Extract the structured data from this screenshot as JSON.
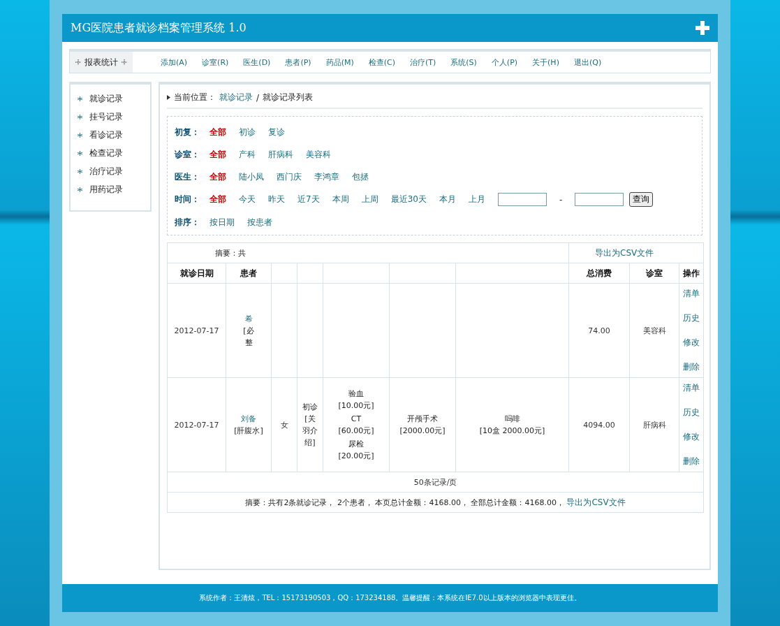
{
  "header": {
    "title": "MG医院患者就诊档案管理系统 1.0"
  },
  "menu": {
    "current": "报表统计",
    "items": [
      "添加(A)",
      "诊室(R)",
      "医生(D)",
      "患者(P)",
      "药品(M)",
      "检查(C)",
      "治疗(T)",
      "系统(S)",
      "个人(P)",
      "关于(H)",
      "退出(Q)"
    ]
  },
  "sidebar": {
    "items": [
      "就诊记录",
      "挂号记录",
      "看诊记录",
      "检查记录",
      "治疗记录",
      "用药记录"
    ]
  },
  "breadcrumb": {
    "label": "当前位置：",
    "link": "就诊记录",
    "separator": "/",
    "current": "就诊记录列表"
  },
  "filters": [
    {
      "kind": "options",
      "label": "初复：",
      "options": [
        {
          "text": "全部",
          "selected": true
        },
        {
          "text": "初诊",
          "selected": false
        },
        {
          "text": "复诊",
          "selected": false
        }
      ]
    },
    {
      "kind": "options",
      "label": "诊室：",
      "options": [
        {
          "text": "全部",
          "selected": true
        },
        {
          "text": "产科",
          "selected": false
        },
        {
          "text": "肝病科",
          "selected": false
        },
        {
          "text": "美容科",
          "selected": false
        }
      ]
    },
    {
      "kind": "options",
      "label": "医生：",
      "options": [
        {
          "text": "全部",
          "selected": true
        },
        {
          "text": "陆小凤",
          "selected": false
        },
        {
          "text": "西门庆",
          "selected": false
        },
        {
          "text": "李鸿章",
          "selected": false
        },
        {
          "text": "包拯",
          "selected": false
        }
      ]
    },
    {
      "kind": "range",
      "label": "时间：",
      "options": [
        {
          "text": "全部",
          "selected": true
        },
        {
          "text": "今天",
          "selected": false
        },
        {
          "text": "昨天",
          "selected": false
        },
        {
          "text": "近7天",
          "selected": false
        },
        {
          "text": "本周",
          "selected": false
        },
        {
          "text": "上周",
          "selected": false
        },
        {
          "text": "最近30天",
          "selected": false
        },
        {
          "text": "本月",
          "selected": false
        },
        {
          "text": "上月",
          "selected": false
        }
      ],
      "separator": "-",
      "button": "查询"
    },
    {
      "kind": "options",
      "label": "排序：",
      "options": [
        {
          "text": "按日期",
          "selected": false
        },
        {
          "text": "按患者",
          "selected": false
        }
      ]
    }
  ],
  "table": {
    "summary_top": {
      "text": "摘要：共",
      "export": "导出为CSV文件"
    },
    "columns": [
      "就诊日期",
      "患者",
      "",
      "",
      "",
      "",
      "",
      "总消费",
      "诊室",
      "操作"
    ],
    "rows": [
      {
        "date": "2012-07-17",
        "patient": [
          "希"
        ],
        "note": [
          "[必",
          "整"
        ],
        "sex": "",
        "visit": [],
        "exams": [],
        "treatment": [],
        "drugs": [],
        "total": "74.00",
        "room": "美容科",
        "actions": [
          "清单",
          "历史",
          "修改",
          "删除"
        ]
      },
      {
        "date": "2012-07-17",
        "patient": [
          "刘备"
        ],
        "note": [
          "[肝腹水]"
        ],
        "sex": "女",
        "visit": [
          "初诊",
          "[关",
          "羽介",
          "绍]"
        ],
        "exams": [
          [
            "验血",
            "[10.00元]"
          ],
          [
            "CT",
            "[60.00元]"
          ],
          [
            "尿检",
            "[20.00元]"
          ]
        ],
        "treatment": [
          "开颅手术",
          "[2000.00元]"
        ],
        "drugs": [
          "吗啡",
          "[10盒 2000.00元]"
        ],
        "total": "4094.00",
        "room": "肝病科",
        "actions": [
          "清单",
          "历史",
          "修改",
          "删除"
        ]
      }
    ],
    "page_size": "50条记录/页",
    "summary_bottom": {
      "text": "摘要：共有2条就诊记录， 2个患者， 本页总计金额：4168.00， 全部总计金额：4168.00，",
      "export": "导出为CSV文件"
    }
  },
  "footer": {
    "text": "系统作者：王清炫，TEL：15173190503，QQ：173234188。温馨提醒：本系统在IE7.0以上版本的浏览器中表现更佳。"
  }
}
